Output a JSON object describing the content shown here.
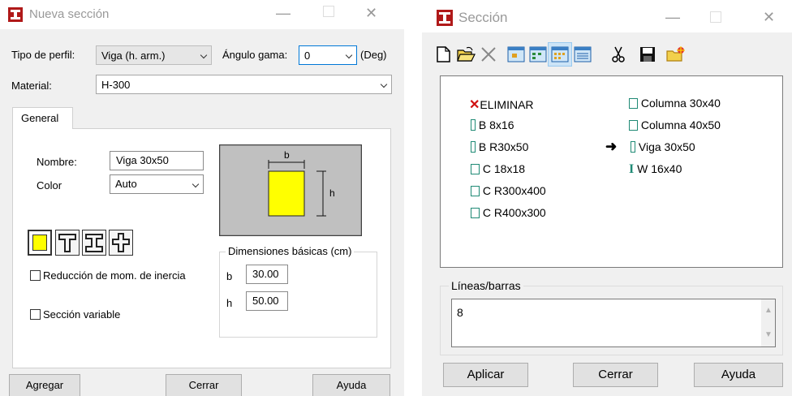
{
  "nueva": {
    "title": "Nueva sección",
    "tipo_label": "Tipo de perfil:",
    "tipo_value": "Viga (h. arm.)",
    "angulo_label": "Ángulo gama:",
    "angulo_value": "0",
    "deg_label": "(Deg)",
    "material_label": "Material:",
    "material_value": "H-300",
    "tab_general": "General",
    "nombre_label": "Nombre:",
    "nombre_value": "Viga 30x50",
    "color_label": "Color",
    "color_value": "Auto",
    "diagram_b": "b",
    "diagram_h": "h",
    "dimensiones_title": "Dimensiones básicas (cm)",
    "dim_b_label": "b",
    "dim_b_value": "30.00",
    "dim_h_label": "h",
    "dim_h_value": "50.00",
    "reduccion_label": "Reducción de mom. de inercia",
    "variable_label": "Sección variable",
    "agregar": "Agregar",
    "cerrar": "Cerrar",
    "ayuda": "Ayuda",
    "section_fill_color": "#ffff00"
  },
  "seccion": {
    "title": "Sección",
    "list_left": [
      {
        "label": "ELIMINAR",
        "icon": "delete-x-icon"
      },
      {
        "label": "B 8x16",
        "icon": "rect-section-icon"
      },
      {
        "label": "B R30x50",
        "icon": "rect-section-icon"
      },
      {
        "label": "C 18x18",
        "icon": "square-section-icon"
      },
      {
        "label": "C R300x400",
        "icon": "square-section-icon"
      },
      {
        "label": "C R400x300",
        "icon": "square-section-icon"
      }
    ],
    "list_right": [
      {
        "label": "Columna 30x40",
        "icon": "square-section-icon"
      },
      {
        "label": "Columna 40x50",
        "icon": "square-section-icon"
      },
      {
        "label": "Viga 30x50",
        "icon": "rect-section-icon",
        "current": true
      },
      {
        "label": "W 16x40",
        "icon": "i-beam-icon"
      }
    ],
    "lineas_label": "Líneas/barras",
    "lineas_value": "8",
    "aplicar": "Aplicar",
    "cerrar": "Cerrar",
    "ayuda": "Ayuda",
    "icon_color": "#1f8a75"
  }
}
